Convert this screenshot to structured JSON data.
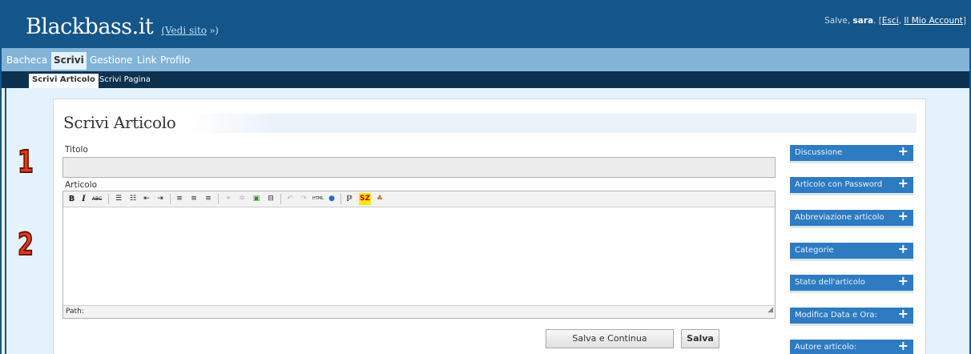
{
  "header": {
    "site_name": "Blackbass.it",
    "view_site": "(Vedi sito",
    "view_site_arrow": " »)",
    "greeting": "Salve, ",
    "username": "sara",
    "userbar_dot": ". [",
    "logout": "Esci",
    "comma": ", ",
    "my_account": "Il Mio Account",
    "close_bracket": "]"
  },
  "mainnav": {
    "items": [
      {
        "label": "Bacheca"
      },
      {
        "label": "Scrivi"
      },
      {
        "label": "Gestione"
      },
      {
        "label": "Link"
      },
      {
        "label": "Profilo"
      }
    ]
  },
  "subnav": {
    "items": [
      {
        "label": "Scrivi Articolo"
      },
      {
        "label": "Scrivi Pagina"
      }
    ]
  },
  "page": {
    "title": "Scrivi Articolo",
    "title_label": "Titolo",
    "title_value": "",
    "content_label": "Articolo",
    "path_label": "Path:",
    "markers": [
      "1",
      "2"
    ]
  },
  "toolbar": {
    "bold": "B",
    "italic": "I",
    "strike": "ABC",
    "html": "HTML",
    "sz": "SZ"
  },
  "buttons": {
    "save_continue": "Salva e Continua",
    "save": "Salva"
  },
  "sidebar": {
    "boxes": [
      {
        "label": "Discussione"
      },
      {
        "label": "Articolo con Password"
      },
      {
        "label": "Abbreviazione articolo"
      },
      {
        "label": "Categorie"
      },
      {
        "label": "Stato dell'articolo"
      },
      {
        "label": "Modifica Data e Ora:"
      },
      {
        "label": "Autore articolo:"
      }
    ],
    "plus": "+"
  },
  "colors": {
    "header_bg": "#14568a",
    "mainnav_bg": "#83b4d8",
    "subnav_bg": "#0d324f",
    "box_bg": "#2e7bc1",
    "marker": "#e33a1a"
  }
}
